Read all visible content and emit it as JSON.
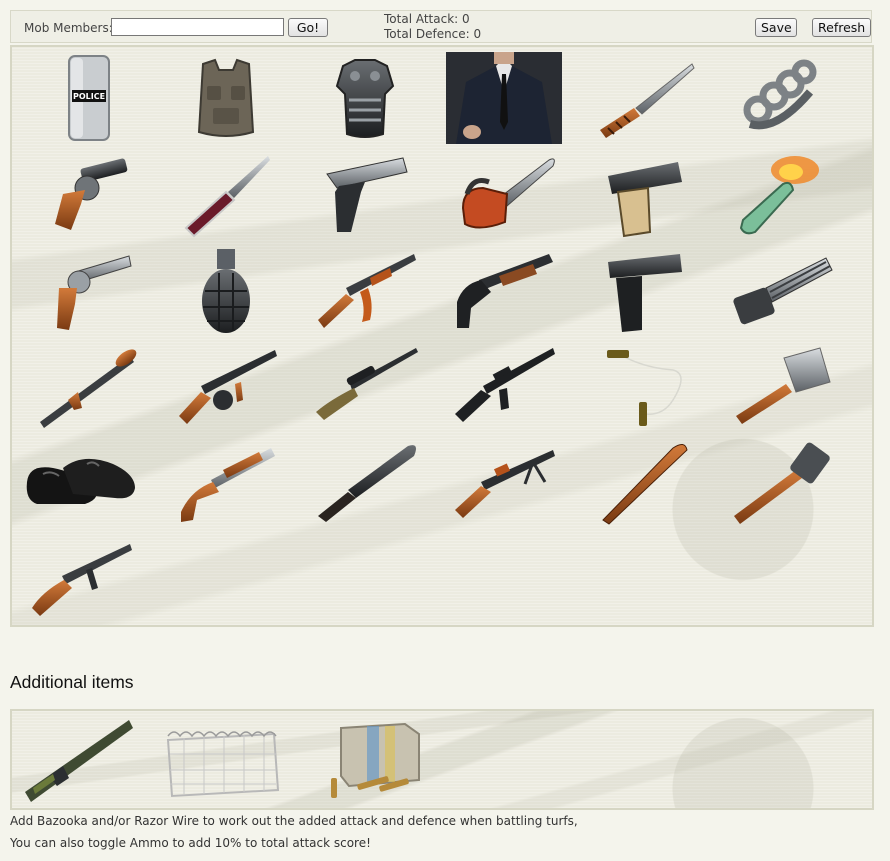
{
  "toolbar": {
    "mob_members_label": "Mob Members:",
    "mob_members_value": "",
    "go_label": "Go!",
    "total_attack_label": "Total Attack:",
    "total_attack_value": "0",
    "total_defence_label": "Total Defence:",
    "total_defence_value": "0",
    "save_label": "Save",
    "refresh_label": "Refresh"
  },
  "weapons": [
    {
      "name": "police-riot-shield-icon",
      "label": "POLICE"
    },
    {
      "name": "tactical-vest-icon"
    },
    {
      "name": "body-armor-icon"
    },
    {
      "name": "suit-icon"
    },
    {
      "name": "knife-icon"
    },
    {
      "name": "brass-knuckles-icon"
    },
    {
      "name": "snub-revolver-icon"
    },
    {
      "name": "switchblade-icon"
    },
    {
      "name": "pistol-icon"
    },
    {
      "name": "chainsaw-icon"
    },
    {
      "name": "small-pistol-icon"
    },
    {
      "name": "molotov-cocktail-icon"
    },
    {
      "name": "revolver-icon"
    },
    {
      "name": "hand-grenade-icon"
    },
    {
      "name": "assault-rifle-icon"
    },
    {
      "name": "shotgun-icon"
    },
    {
      "name": "glock-pistol-icon"
    },
    {
      "name": "minigun-icon"
    },
    {
      "name": "rpg-launcher-icon"
    },
    {
      "name": "tommy-gun-icon"
    },
    {
      "name": "sniper-rifle-icon"
    },
    {
      "name": "m16-rifle-icon"
    },
    {
      "name": "garrote-wire-icon"
    },
    {
      "name": "meat-cleaver-icon"
    },
    {
      "name": "dress-shoes-icon"
    },
    {
      "name": "sawed-off-shotgun-icon"
    },
    {
      "name": "machete-icon"
    },
    {
      "name": "machine-gun-icon"
    },
    {
      "name": "baseball-bat-icon"
    },
    {
      "name": "stick-grenade-icon"
    },
    {
      "name": "submachine-gun-icon"
    }
  ],
  "additional": {
    "title": "Additional items",
    "items": [
      {
        "name": "bazooka-icon"
      },
      {
        "name": "razor-wire-icon"
      },
      {
        "name": "ammo-crate-icon"
      }
    ],
    "note_line1": "Add Bazooka and/or Razor Wire to work out the added attack and defence when battling turfs,",
    "note_line2": "You can also toggle Ammo to add 10% to total attack score!"
  }
}
